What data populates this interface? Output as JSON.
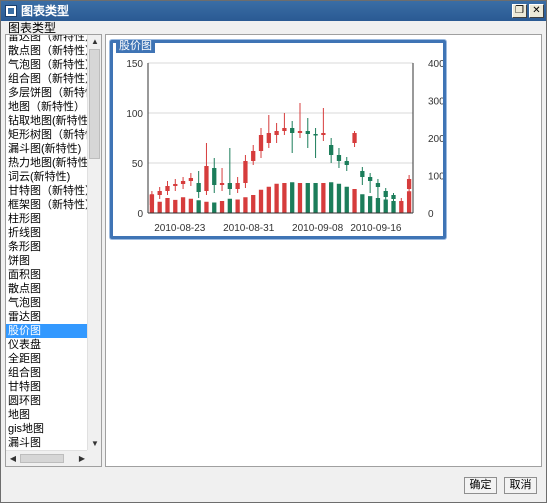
{
  "window": {
    "title": "图表类型",
    "restore_glyph": "❐",
    "close_glyph": "✕"
  },
  "section_label": "图表类型",
  "chart_types": [
    {
      "label": "雷达图（新特性）"
    },
    {
      "label": "散点图（新特性）"
    },
    {
      "label": "气泡图（新特性）"
    },
    {
      "label": "组合图（新特性）"
    },
    {
      "label": "多层饼图（新特性）"
    },
    {
      "label": "地图（新特性）"
    },
    {
      "label": "钻取地图(新特性)"
    },
    {
      "label": "矩形树图（新特性）"
    },
    {
      "label": "漏斗图(新特性)"
    },
    {
      "label": "热力地图(新特性)"
    },
    {
      "label": "词云(新特性)"
    },
    {
      "label": "甘特图（新特性）"
    },
    {
      "label": "框架图（新特性）"
    },
    {
      "label": "柱形图"
    },
    {
      "label": "折线图"
    },
    {
      "label": "条形图"
    },
    {
      "label": "饼图"
    },
    {
      "label": "面积图"
    },
    {
      "label": "散点图"
    },
    {
      "label": "气泡图"
    },
    {
      "label": "雷达图"
    },
    {
      "label": "股价图",
      "selected": true
    },
    {
      "label": "仪表盘"
    },
    {
      "label": "全距图"
    },
    {
      "label": "组合图"
    },
    {
      "label": "甘特图"
    },
    {
      "label": "圆环图"
    },
    {
      "label": "地图"
    },
    {
      "label": "gis地图"
    },
    {
      "label": "漏斗图"
    }
  ],
  "preview": {
    "label": "股价图"
  },
  "chart_data": {
    "type": "bar",
    "title": "",
    "x_tick_labels": [
      "2010-08-23",
      "2010-08-31",
      "2010-09-08",
      "2010-09-16"
    ],
    "y_left_ticks": [
      "0",
      "50",
      "100",
      "150"
    ],
    "y_right_ticks": [
      "0",
      "100",
      "200",
      "300",
      "400"
    ],
    "y_left_range": [
      0,
      150
    ],
    "y_right_range": [
      0,
      400
    ],
    "candles": [
      {
        "open": 8,
        "close": 18,
        "high": 22,
        "low": 5
      },
      {
        "open": 18,
        "close": 22,
        "high": 26,
        "low": 14
      },
      {
        "open": 22,
        "close": 27,
        "high": 32,
        "low": 18
      },
      {
        "open": 27,
        "close": 29,
        "high": 34,
        "low": 22
      },
      {
        "open": 29,
        "close": 32,
        "high": 36,
        "low": 24
      },
      {
        "open": 32,
        "close": 35,
        "high": 40,
        "low": 27
      },
      {
        "open": 30,
        "close": 21,
        "high": 42,
        "low": 15
      },
      {
        "open": 22,
        "close": 47,
        "high": 70,
        "low": 18
      },
      {
        "open": 45,
        "close": 28,
        "high": 55,
        "low": 20
      },
      {
        "open": 28,
        "close": 30,
        "high": 45,
        "low": 22
      },
      {
        "open": 30,
        "close": 24,
        "high": 65,
        "low": 18
      },
      {
        "open": 24,
        "close": 30,
        "high": 36,
        "low": 20
      },
      {
        "open": 30,
        "close": 52,
        "high": 58,
        "low": 25
      },
      {
        "open": 52,
        "close": 62,
        "high": 68,
        "low": 48
      },
      {
        "open": 62,
        "close": 78,
        "high": 85,
        "low": 55
      },
      {
        "open": 70,
        "close": 80,
        "high": 98,
        "low": 65
      },
      {
        "open": 78,
        "close": 82,
        "high": 90,
        "low": 70
      },
      {
        "open": 82,
        "close": 85,
        "high": 100,
        "low": 78
      },
      {
        "open": 85,
        "close": 80,
        "high": 92,
        "low": 60
      },
      {
        "open": 80,
        "close": 82,
        "high": 110,
        "low": 75
      },
      {
        "open": 82,
        "close": 79,
        "high": 95,
        "low": 65
      },
      {
        "open": 79,
        "close": 78,
        "high": 85,
        "low": 55
      },
      {
        "open": 78,
        "close": 80,
        "high": 105,
        "low": 72
      },
      {
        "open": 68,
        "close": 58,
        "high": 75,
        "low": 50
      },
      {
        "open": 58,
        "close": 52,
        "high": 65,
        "low": 45
      },
      {
        "open": 52,
        "close": 48,
        "high": 56,
        "low": 42
      },
      {
        "open": 70,
        "close": 80,
        "high": 82,
        "low": 66
      },
      {
        "open": 42,
        "close": 36,
        "high": 46,
        "low": 28
      },
      {
        "open": 36,
        "close": 32,
        "high": 40,
        "low": 20
      },
      {
        "open": 30,
        "close": 26,
        "high": 34,
        "low": 15
      },
      {
        "open": 22,
        "close": 16,
        "high": 25,
        "low": 12
      },
      {
        "open": 18,
        "close": 14,
        "high": 20,
        "low": 5
      },
      {
        "open": 10,
        "close": 12,
        "high": 15,
        "low": 0
      },
      {
        "open": 24,
        "close": 34,
        "high": 38,
        "low": 18
      }
    ],
    "volumes": [
      50,
      30,
      40,
      35,
      42,
      38,
      34,
      30,
      28,
      32,
      38,
      36,
      42,
      48,
      62,
      70,
      78,
      80,
      82,
      80,
      80,
      80,
      80,
      82,
      78,
      70,
      64,
      50,
      45,
      40,
      36,
      32,
      28,
      58
    ],
    "colors": {
      "up": "#d63c3c",
      "down": "#1b7d5a",
      "grid": "#d9d9d9",
      "axis": "#333333"
    }
  },
  "buttons": {
    "ok": "确定",
    "cancel": "取消"
  }
}
